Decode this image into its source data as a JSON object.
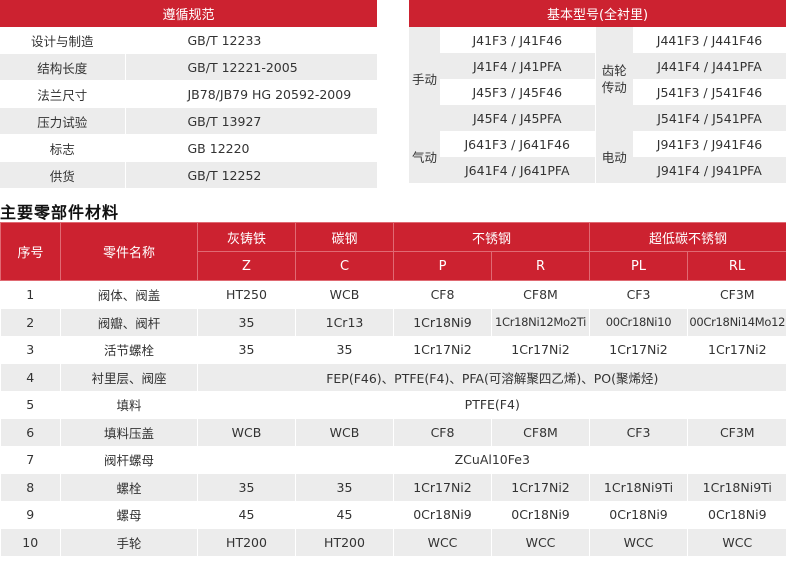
{
  "standards": {
    "title": "遵循规范",
    "rows": [
      {
        "label": "设计与制造",
        "value": "GB/T 12233"
      },
      {
        "label": "结构长度",
        "value": "GB/T 12221-2005"
      },
      {
        "label": "法兰尺寸",
        "value": "JB78/JB79 HG 20592-2009"
      },
      {
        "label": "压力试验",
        "value": "GB/T 13927"
      },
      {
        "label": "标志",
        "value": "GB 12220"
      },
      {
        "label": "供货",
        "value": "GB/T 12252"
      }
    ]
  },
  "models": {
    "title": "基本型号(全衬里)",
    "groups": {
      "manual": "手动",
      "gear_line1": "齿轮",
      "gear_line2": "传动",
      "pneumatic": "气动",
      "electric": "电动"
    },
    "left": [
      "J41F3 / J41F46",
      "J41F4 / J41PFA",
      "J45F3 / J45F46",
      "J45F4 / J45PFA",
      "J641F3 / J641F46",
      "J641F4 / J641PFA"
    ],
    "right": [
      "J441F3 / J441F46",
      "J441F4 / J441PFA",
      "J541F3 / J541F46",
      "J541F4 / J541PFA",
      "J941F3 / J941F46",
      "J941F4 / J941PFA"
    ]
  },
  "materials": {
    "section_title": "主要零部件材料",
    "headers": {
      "no": "序号",
      "part": "零件名称",
      "gray_iron": "灰铸铁",
      "carbon_steel": "碳钢",
      "stainless": "不锈钢",
      "ultra_low_carbon": "超低碳不锈钢",
      "codes": [
        "Z",
        "C",
        "P",
        "R",
        "PL",
        "RL"
      ]
    },
    "rows": [
      {
        "no": "1",
        "part": "阀体、阀盖",
        "cells": [
          "HT250",
          "WCB",
          "CF8",
          "CF8M",
          "CF3",
          "CF3M"
        ]
      },
      {
        "no": "2",
        "part": "阀瓣、阀杆",
        "cells": [
          "35",
          "1Cr13",
          "1Cr18Ni9",
          "1Cr18Ni12Mo2Ti",
          "00Cr18Ni10",
          "00Cr18Ni14Mo12"
        ]
      },
      {
        "no": "3",
        "part": "活节螺栓",
        "cells": [
          "35",
          "35",
          "1Cr17Ni2",
          "1Cr17Ni2",
          "1Cr17Ni2",
          "1Cr17Ni2"
        ]
      },
      {
        "no": "4",
        "part": "衬里层、阀座",
        "span": "FEP(F46)、PTFE(F4)、PFA(可溶解聚四乙烯)、PO(聚烯烃)"
      },
      {
        "no": "5",
        "part": "填料",
        "span": "PTFE(F4)"
      },
      {
        "no": "6",
        "part": "填料压盖",
        "cells": [
          "WCB",
          "WCB",
          "CF8",
          "CF8M",
          "CF3",
          "CF3M"
        ]
      },
      {
        "no": "7",
        "part": "阀杆螺母",
        "span": "ZCuAl10Fe3"
      },
      {
        "no": "8",
        "part": "螺栓",
        "cells": [
          "35",
          "35",
          "1Cr17Ni2",
          "1Cr17Ni2",
          "1Cr18Ni9Ti",
          "1Cr18Ni9Ti"
        ]
      },
      {
        "no": "9",
        "part": "螺母",
        "cells": [
          "45",
          "45",
          "0Cr18Ni9",
          "0Cr18Ni9",
          "0Cr18Ni9",
          "0Cr18Ni9"
        ]
      },
      {
        "no": "10",
        "part": "手轮",
        "cells": [
          "HT200",
          "HT200",
          "WCC",
          "WCC",
          "WCC",
          "WCC"
        ]
      }
    ]
  }
}
